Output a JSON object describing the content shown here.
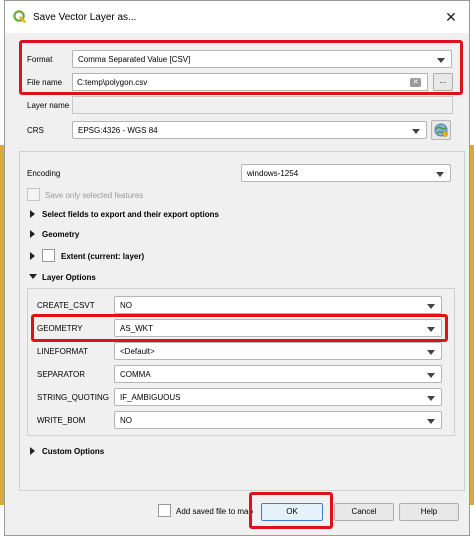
{
  "window": {
    "title": "Save Vector Layer as...",
    "close_glyph": "✕",
    "logo_icon": "qgis-logo-icon"
  },
  "format": {
    "label": "Format",
    "value": "Comma Separated Value [CSV]"
  },
  "file_name": {
    "label": "File name",
    "value": "C:temp\\polygon.csv",
    "browse_label": "..."
  },
  "layer_name": {
    "label": "Layer name",
    "value": ""
  },
  "crs": {
    "label": "CRS",
    "value": "EPSG:4326 - WGS 84"
  },
  "encoding": {
    "label": "Encoding",
    "value": "windows-1254"
  },
  "save_selected": {
    "label": "Save only selected features",
    "checked": false
  },
  "sections": {
    "select_fields": "Select fields to export and their export options",
    "geometry": "Geometry",
    "extent": "Extent (current: layer)",
    "layer_options": "Layer Options",
    "custom_options": "Custom Options"
  },
  "layer_options": [
    {
      "name": "CREATE_CSVT",
      "value": "NO"
    },
    {
      "name": "GEOMETRY",
      "value": "AS_WKT"
    },
    {
      "name": "LINEFORMAT",
      "value": "<Default>"
    },
    {
      "name": "SEPARATOR",
      "value": "COMMA"
    },
    {
      "name": "STRING_QUOTING",
      "value": "IF_AMBIGUOUS"
    },
    {
      "name": "WRITE_BOM",
      "value": "NO"
    }
  ],
  "footer": {
    "add_to_map": "Add saved file to map",
    "ok": "OK",
    "cancel": "Cancel",
    "help": "Help"
  },
  "colors": {
    "highlight": "#e0101a",
    "dialog_bg": "#f0f0f0",
    "accent_bg_strip": "#d9a93a"
  }
}
